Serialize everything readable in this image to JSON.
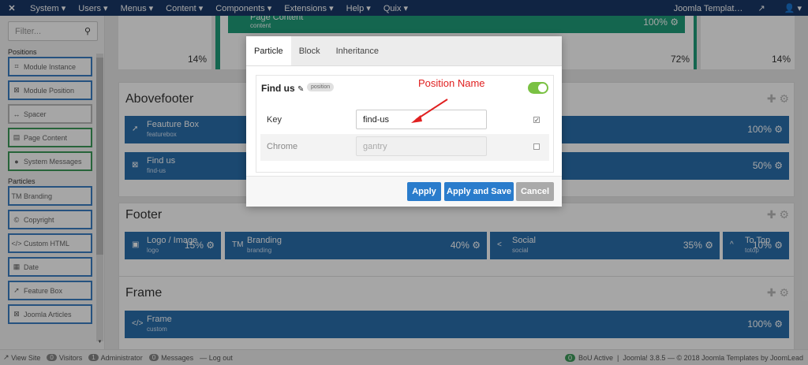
{
  "topbar": {
    "logo": "✕",
    "menus": [
      "System ▾",
      "Users ▾",
      "Menus ▾",
      "Content ▾",
      "Components ▾",
      "Extensions ▾",
      "Help ▾",
      "Quix ▾"
    ],
    "site_link": "Joomla Templat…",
    "user_icon": "user-icon"
  },
  "sidebar": {
    "filter_placeholder": "Filter...",
    "positions_label": "Positions",
    "positions": [
      {
        "label": "Module Instance",
        "icon": "⌗",
        "kind": "pos"
      },
      {
        "label": "Module Position",
        "icon": "⊠",
        "kind": "pos"
      },
      {
        "label": "Spacer",
        "icon": "↔",
        "kind": "spc"
      },
      {
        "label": "Page Content",
        "icon": "▤",
        "kind": "cnt"
      },
      {
        "label": "System Messages",
        "icon": "●",
        "kind": "cnt"
      }
    ],
    "particles_label": "Particles",
    "particles": [
      {
        "label": "Branding",
        "icon": "TM"
      },
      {
        "label": "Copyright",
        "icon": "©"
      },
      {
        "label": "Custom HTML",
        "icon": "</>"
      },
      {
        "label": "Date",
        "icon": "▦"
      },
      {
        "label": "Feature Box",
        "icon": "➚"
      },
      {
        "label": "Joomla Articles",
        "icon": "⊠"
      }
    ]
  },
  "main": {
    "top": {
      "left_pct": "14%",
      "content_title": "Page Content",
      "content_sub": "content",
      "content_pct": "100%",
      "mid_pct": "72%",
      "right_pct": "14%"
    },
    "abovefooter": {
      "title": "Abovefooter",
      "blocks": [
        {
          "title": "Feauture Box",
          "sub": "featurebox",
          "pct": "100%",
          "icon": "➚"
        },
        {
          "title": "Find us",
          "sub": "find-us",
          "pct": "50%",
          "icon": "⊠"
        }
      ]
    },
    "footer": {
      "title": "Footer",
      "blocks": [
        {
          "title": "Logo / Image",
          "sub": "logo",
          "pct": "15%",
          "icon": "▣"
        },
        {
          "title": "Branding",
          "sub": "branding",
          "pct": "40%",
          "icon": "TM"
        },
        {
          "title": "Social",
          "sub": "social",
          "pct": "35%",
          "icon": "<"
        },
        {
          "title": "To Top",
          "sub": "totop",
          "pct": "10%",
          "icon": "^"
        }
      ]
    },
    "frame": {
      "title": "Frame",
      "blocks": [
        {
          "title": "Frame",
          "sub": "custom",
          "pct": "100%",
          "icon": "</>"
        }
      ]
    }
  },
  "modal": {
    "tabs": [
      "Particle",
      "Block",
      "Inheritance"
    ],
    "title": "Find us",
    "badge": "position",
    "rows": [
      {
        "label": "Key",
        "value": "find-us",
        "checked": true
      },
      {
        "label": "Chrome",
        "value": "gantry",
        "checked": false
      }
    ],
    "buttons": {
      "apply": "Apply",
      "save": "Apply and Save",
      "cancel": "Cancel"
    },
    "annotation": "Position Name"
  },
  "statusbar": {
    "view_site": "View Site",
    "visitors_count": "0",
    "visitors": "Visitors",
    "admin_count": "1",
    "admin": "Administrator",
    "messages_count": "0",
    "messages": "Messages",
    "logout": "Log out",
    "bou_count": "0",
    "bou": "BoU Active",
    "version": "Joomla! 3.8.5",
    "copyright": "— © 2018 Joomla Templates by JoomLead"
  },
  "colors": {
    "topbar": "#1a3867",
    "block": "#2a6fad",
    "content": "#1f9d7a",
    "apply": "#2a7ccc",
    "annotation": "#e02020"
  }
}
